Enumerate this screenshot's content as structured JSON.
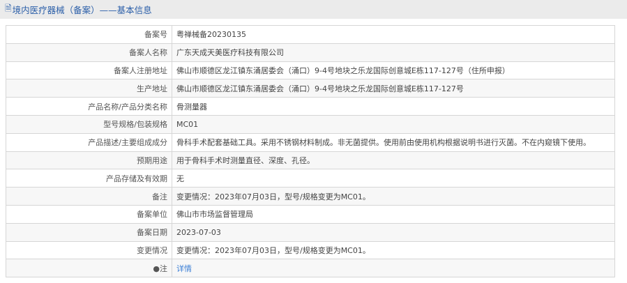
{
  "header": {
    "icon": "document-icon",
    "title": "境内医疗器械（备案）——基本信息"
  },
  "rows": [
    {
      "label": "备案号",
      "value": "粤禅械备20230135"
    },
    {
      "label": "备案人名称",
      "value": "广东天成天美医疗科技有限公司"
    },
    {
      "label": "备案人注册地址",
      "value": "佛山市顺德区龙江镇东涌居委会（涌口）9-4号地块之乐龙国际创意城E栋117-127号（住所申报）"
    },
    {
      "label": "生产地址",
      "value": "佛山市顺德区龙江镇东涌居委会（涌口）9-4号地块之乐龙国际创意城E栋117-127号"
    },
    {
      "label": "产品名称/产品分类名称",
      "value": "骨测量器"
    },
    {
      "label": "型号规格/包装规格",
      "value": "MC01"
    },
    {
      "label": "产品描述/主要组成成分",
      "value": "骨科手术配套基础工具。采用不锈钢材料制成。非无菌提供。使用前由使用机构根据说明书进行灭菌。不在内窥镜下使用。"
    },
    {
      "label": "预期用途",
      "value": "用于骨科手术时测量直径、深度、孔径。"
    },
    {
      "label": "产品存储及有效期",
      "value": "无"
    },
    {
      "label": "备注",
      "value": "变更情况：2023年07月03日，型号/规格变更为MC01。"
    },
    {
      "label": "备案单位",
      "value": "佛山市市场监督管理局"
    },
    {
      "label": "备案日期",
      "value": "2023-07-03"
    },
    {
      "label": "变更情况",
      "value": "变更情况：2023年07月03日，型号/规格变更为MC01。"
    }
  ],
  "note": {
    "icon": "pin-icon",
    "label": "注",
    "link": "详情"
  }
}
